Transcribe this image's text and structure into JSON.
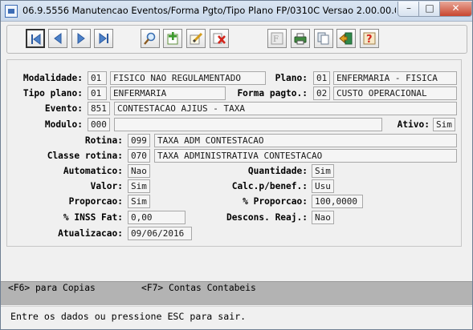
{
  "window": {
    "title": "06.9.5556 Manutencao  Eventos/Forma Pgto/Tipo Plano FP/0310C Versao 2.00.00.023 10/08/20..."
  },
  "toolbar": {
    "buttons": [
      "first-record",
      "previous-record",
      "next-record",
      "last-record",
      "search",
      "add-record",
      "edit-record",
      "delete-record",
      "filter",
      "print",
      "copy",
      "exit",
      "help"
    ]
  },
  "form": {
    "modalidade": {
      "label": "Modalidade:",
      "code": "01",
      "desc": "FISICO NAO REGULAMENTADO"
    },
    "plano": {
      "label": "Plano:",
      "code": "01",
      "desc": "ENFERMARIA - FISICA"
    },
    "tipo_plano": {
      "label": "Tipo plano:",
      "code": "01",
      "desc": "ENFERMARIA"
    },
    "forma_pagto": {
      "label": "Forma pagto.:",
      "code": "02",
      "desc": "CUSTO OPERACIONAL"
    },
    "evento": {
      "label": "Evento:",
      "code": "851",
      "desc": "CONTESTACAO AJIUS - TAXA"
    },
    "modulo": {
      "label": "Modulo:",
      "code": "000",
      "desc": ""
    },
    "ativo": {
      "label": "Ativo:",
      "value": "Sim"
    },
    "rotina": {
      "label": "Rotina:",
      "code": "099",
      "desc": "TAXA ADM CONTESTACAO"
    },
    "classe_rotina": {
      "label": "Classe rotina:",
      "code": "070",
      "desc": "TAXA ADMINISTRATIVA CONTESTACAO"
    },
    "automatico": {
      "label": "Automatico:",
      "value": "Nao"
    },
    "quantidade": {
      "label": "Quantidade:",
      "value": "Sim"
    },
    "valor": {
      "label": "Valor:",
      "value": "Sim"
    },
    "calc_benef": {
      "label": "Calc.p/benef.:",
      "value": "Usu"
    },
    "proporcao": {
      "label": "Proporcao:",
      "value": "Sim"
    },
    "pct_proporcao": {
      "label": "% Proporcao:",
      "value": "100,0000"
    },
    "pct_inss": {
      "label": "% INSS Fat:",
      "value": "0,00"
    },
    "descons_reaj": {
      "label": "Descons. Reaj.:",
      "value": "Nao"
    },
    "atualizacao": {
      "label": "Atualizacao:",
      "value": "09/06/2016"
    }
  },
  "fkeys": {
    "f6": "<F6> para Copias",
    "f7": "<F7> Contas Contabeis"
  },
  "status": {
    "message": "Entre os dados ou pressione ESC para sair."
  }
}
